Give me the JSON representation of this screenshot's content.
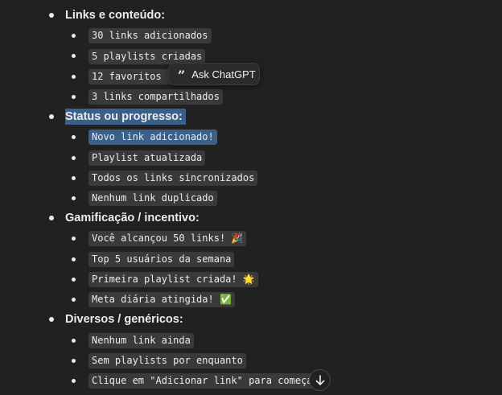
{
  "sections": [
    {
      "heading": "Links e conteúdo:",
      "items": [
        "30 links adicionados",
        "5 playlists criadas",
        "12 favoritos salvos",
        "3 links compartilhados"
      ]
    },
    {
      "heading": "Status ou progresso:",
      "items": [
        "Novo link adicionado!",
        "Playlist atualizada",
        "Todos os links sincronizados",
        "Nenhum link duplicado"
      ]
    },
    {
      "heading": "Gamificação / incentivo:",
      "items": [
        "Você alcançou 50 links! 🎉",
        "Top 5 usuários da semana",
        "Primeira playlist criada! 🌟",
        "Meta diária atingida! ✅"
      ]
    },
    {
      "heading": "Diversos / genéricos:",
      "items": [
        "Nenhum link ainda",
        "Sem playlists por enquanto",
        "Clique em \"Adicionar link\" para começar"
      ]
    }
  ],
  "tooltip": {
    "icon": "quote-icon",
    "label": "Ask ChatGPT"
  },
  "scroll_button": {
    "icon": "arrow-down-icon"
  },
  "colors": {
    "background": "#212121",
    "code_background": "#3a3a3a",
    "selection": "#3a5f88",
    "text": "#ececec"
  }
}
